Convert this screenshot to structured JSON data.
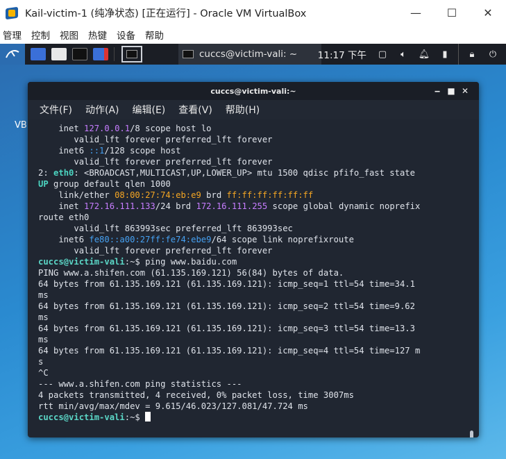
{
  "vbox": {
    "title": "Kail-victim-1 (纯净状态) [正在运行] - Oracle VM VirtualBox",
    "menu": [
      "管理",
      "控制",
      "视图",
      "热键",
      "设备",
      "帮助"
    ],
    "controls": {
      "minimize": "—",
      "maximize": "☐",
      "close": "✕"
    }
  },
  "panel": {
    "task_label": "cuccs@victim-vali: ~",
    "clock": "11:17 下午",
    "tray_icons": [
      "window-icon",
      "volume-icon",
      "bell-icon",
      "battery-icon",
      "lock-icon",
      "power-icon"
    ]
  },
  "desktop": {
    "vb_label": "VB"
  },
  "terminal": {
    "title": "cuccs@victim-vali:~",
    "controls": {
      "minimize": "‒",
      "maximize": "■",
      "close": "✕"
    },
    "menu": [
      "文件(F)",
      "动作(A)",
      "编辑(E)",
      "查看(V)",
      "帮助(H)"
    ],
    "lines": [
      [
        {
          "t": "    inet "
        },
        {
          "t": "127.0.0.1",
          "c": "purple"
        },
        {
          "t": "/8 scope host lo"
        }
      ],
      [
        {
          "t": "       valid_lft forever preferred_lft forever"
        }
      ],
      [
        {
          "t": "    inet6 "
        },
        {
          "t": "::1",
          "c": "blue"
        },
        {
          "t": "/128 scope host"
        }
      ],
      [
        {
          "t": "       valid_lft forever preferred_lft forever"
        }
      ],
      [
        {
          "t": "2: "
        },
        {
          "t": "eth0",
          "c": "teal"
        },
        {
          "t": ": <BROADCAST,MULTICAST,UP,LOWER_UP> mtu 1500 qdisc pfifo_fast state"
        }
      ],
      [
        {
          "t": "UP",
          "c": "teal"
        },
        {
          "t": " group default qlen 1000"
        }
      ],
      [
        {
          "t": "    link/ether "
        },
        {
          "t": "08:00:27:74:eb:e9",
          "c": "orange"
        },
        {
          "t": " brd "
        },
        {
          "t": "ff:ff:ff:ff:ff:ff",
          "c": "orange"
        }
      ],
      [
        {
          "t": "    inet "
        },
        {
          "t": "172.16.111.133",
          "c": "purple"
        },
        {
          "t": "/24 brd "
        },
        {
          "t": "172.16.111.255",
          "c": "purple"
        },
        {
          "t": " scope global dynamic noprefix"
        }
      ],
      [
        {
          "t": "route eth0"
        }
      ],
      [
        {
          "t": "       valid_lft 863993sec preferred_lft 863993sec"
        }
      ],
      [
        {
          "t": "    inet6 "
        },
        {
          "t": "fe80::a00:27ff:fe74:ebe9",
          "c": "blue"
        },
        {
          "t": "/64 scope link noprefixroute"
        }
      ],
      [
        {
          "t": "       valid_lft forever preferred_lft forever"
        }
      ],
      [
        {
          "t": "cuccs@victim-vali",
          "c": "green"
        },
        {
          "t": ":~$ ping www.baidu.com"
        }
      ],
      [
        {
          "t": "PING www.a.shifen.com (61.135.169.121) 56(84) bytes of data."
        }
      ],
      [
        {
          "t": "64 bytes from 61.135.169.121 (61.135.169.121): icmp_seq=1 ttl=54 time=34.1"
        }
      ],
      [
        {
          "t": "ms"
        }
      ],
      [
        {
          "t": "64 bytes from 61.135.169.121 (61.135.169.121): icmp_seq=2 ttl=54 time=9.62"
        }
      ],
      [
        {
          "t": "ms"
        }
      ],
      [
        {
          "t": "64 bytes from 61.135.169.121 (61.135.169.121): icmp_seq=3 ttl=54 time=13.3"
        }
      ],
      [
        {
          "t": "ms"
        }
      ],
      [
        {
          "t": "64 bytes from 61.135.169.121 (61.135.169.121): icmp_seq=4 ttl=54 time=127 m"
        }
      ],
      [
        {
          "t": "s"
        }
      ],
      [
        {
          "t": "^C"
        }
      ],
      [
        {
          "t": "--- www.a.shifen.com ping statistics ---"
        }
      ],
      [
        {
          "t": "4 packets transmitted, 4 received, 0% packet loss, time 3007ms"
        }
      ],
      [
        {
          "t": "rtt min/avg/max/mdev = 9.615/46.023/127.081/47.724 ms"
        }
      ],
      [
        {
          "t": "cuccs@victim-vali",
          "c": "green"
        },
        {
          "t": ":~$ "
        }
      ]
    ]
  }
}
